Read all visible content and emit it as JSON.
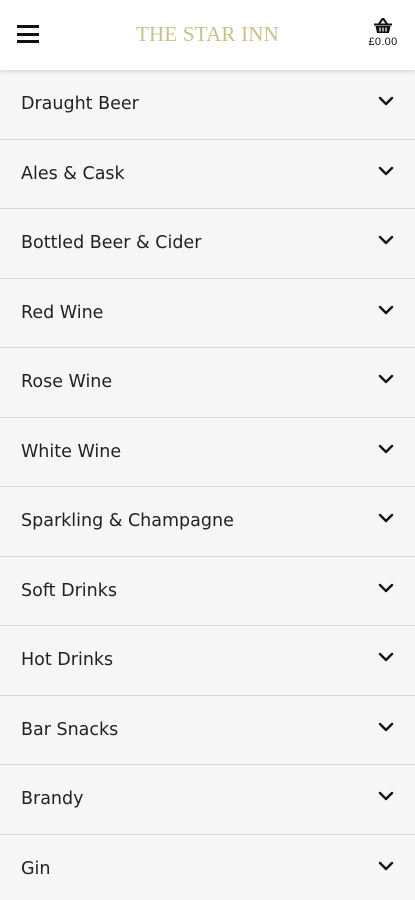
{
  "header": {
    "title": "THE STAR INN",
    "menu_icon": "hamburger-menu-icon",
    "basket_icon": "basket-icon",
    "basket_total": "£0.00"
  },
  "colors": {
    "logo": "#c9c08a",
    "background": "#f6f6f6",
    "divider": "#d7d7d7",
    "text": "#222222"
  },
  "categories": [
    {
      "label": "Draught Beer",
      "icon": "chevron-down-icon"
    },
    {
      "label": "Ales & Cask",
      "icon": "chevron-down-icon"
    },
    {
      "label": "Bottled Beer & Cider",
      "icon": "chevron-down-icon"
    },
    {
      "label": "Red Wine",
      "icon": "chevron-down-icon"
    },
    {
      "label": "Rose Wine",
      "icon": "chevron-down-icon"
    },
    {
      "label": "White Wine",
      "icon": "chevron-down-icon"
    },
    {
      "label": "Sparkling & Champagne",
      "icon": "chevron-down-icon"
    },
    {
      "label": "Soft Drinks",
      "icon": "chevron-down-icon"
    },
    {
      "label": "Hot Drinks",
      "icon": "chevron-down-icon"
    },
    {
      "label": "Bar Snacks",
      "icon": "chevron-down-icon"
    },
    {
      "label": "Brandy",
      "icon": "chevron-down-icon"
    },
    {
      "label": "Gin",
      "icon": "chevron-down-icon"
    }
  ]
}
